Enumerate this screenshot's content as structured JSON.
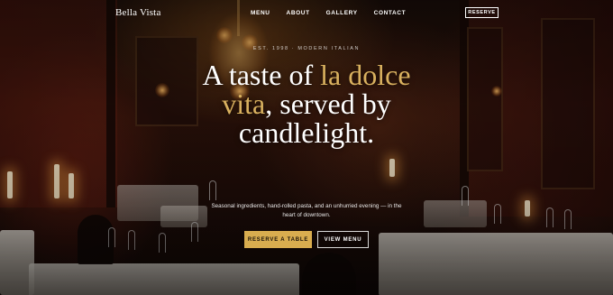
{
  "brand": {
    "name": "Bella Vista"
  },
  "nav": {
    "items": [
      {
        "label": "MENU"
      },
      {
        "label": "ABOUT"
      },
      {
        "label": "GALLERY"
      },
      {
        "label": "CONTACT"
      }
    ],
    "reserve_label": "RESERVE"
  },
  "hero": {
    "eyebrow": "EST. 1998 · MODERN ITALIAN",
    "headline_part1": "A taste of ",
    "headline_accent": "la dolce vita",
    "headline_part2": ", served by candlelight.",
    "subtext": "Seasonal ingredients, hand-rolled pasta, and an unhurried evening — in the heart of downtown.",
    "primary_cta": "RESERVE A TABLE",
    "secondary_cta": "VIEW MENU"
  },
  "colors": {
    "accent": "#d9ad4f",
    "background": "#1a0d09",
    "text": "#ffffff"
  }
}
